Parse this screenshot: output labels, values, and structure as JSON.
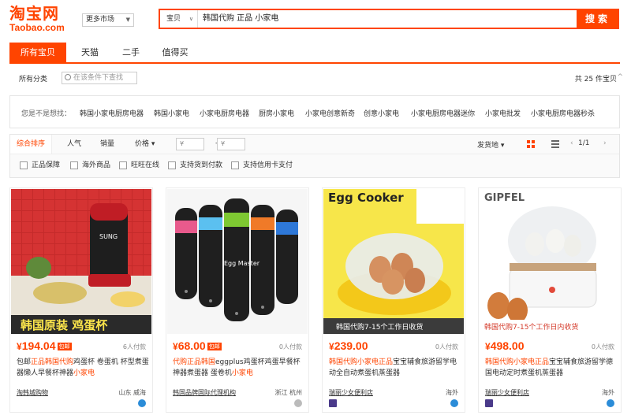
{
  "logo": {
    "cn": "淘宝网",
    "en": "Taobao.com"
  },
  "market": {
    "label": "更多市场"
  },
  "search": {
    "category": "宝贝",
    "query": "韩国代购 正品 小家电",
    "button": "搜索"
  },
  "tabs": [
    "所有宝贝",
    "天猫",
    "二手",
    "值得买"
  ],
  "filter": {
    "label": "所有分类",
    "placeholder": "在该条件下查找",
    "total": "共 25 件宝贝"
  },
  "suggest": {
    "title": "您是不是想找：",
    "items": [
      "韩国小家电厨房电器",
      "韩国小家电",
      "小家电厨房电器",
      "厨房小家电",
      "小家电创意新奇",
      "创意小家电",
      "小家电厨房电器迷你",
      "小家电批发",
      "小家电厨房电器秒杀"
    ]
  },
  "sort": {
    "items": [
      "综合排序",
      "人气",
      "销量",
      "价格"
    ],
    "price_from": "¥",
    "price_to": "¥",
    "ship_from": "发货地",
    "page": "1/1",
    "checks": [
      "正品保障",
      "海外商品",
      "旺旺在线",
      "支持货到付款",
      "支持信用卡支付"
    ]
  },
  "products": [
    {
      "price": "194.04",
      "tag": "包邮",
      "sold": "6人付款",
      "title_pre": "包邮",
      "title_hl": "正品韩国代购",
      "title_mid": "鸡蛋杯 卷蛋机 杯型煮蛋器懒人早餐杯神器",
      "title_hl2": "小家电",
      "shop": "淘韩城购物",
      "location": "山东 威海",
      "overlay": "韩国原装 鸡蛋杯",
      "brand": "SUNG"
    },
    {
      "price": "68.00",
      "tag": "包邮",
      "sold": "0人付款",
      "title_pre": "",
      "title_hl": "代购正品韩国",
      "title_mid": "eggplus鸡蛋杯鸡蛋早餐杯神器煮蛋器 蛋卷机",
      "title_hl2": "小家电",
      "shop": "韩国品牌国际代理机构",
      "location": "浙江 杭州",
      "overlay": "",
      "brand": "Egg Master"
    },
    {
      "price": "239.00",
      "tag": "",
      "sold": "0人付款",
      "title_pre": "",
      "title_hl": "韩国代购小家电正品",
      "title_mid": "宝宝辅食旅游留学电动全自动煮蛋机蒸蛋器",
      "title_hl2": "",
      "shop": "瑞丽少女便利店",
      "location": "海外",
      "overlay": "韩国代购7-15个工作日收货",
      "brand": "Egg Cooker"
    },
    {
      "price": "498.00",
      "tag": "",
      "sold": "0人付款",
      "title_pre": "",
      "title_hl": "韩国代购小家电正品",
      "title_mid": "宝宝辅食旅游留学德国电动定时煮蛋机蒸蛋器",
      "title_hl2": "",
      "shop": "瑞丽少女便利店",
      "location": "海外",
      "overlay": "韩国代购7-15个工作日内收货",
      "brand": "GIPFEL"
    }
  ]
}
